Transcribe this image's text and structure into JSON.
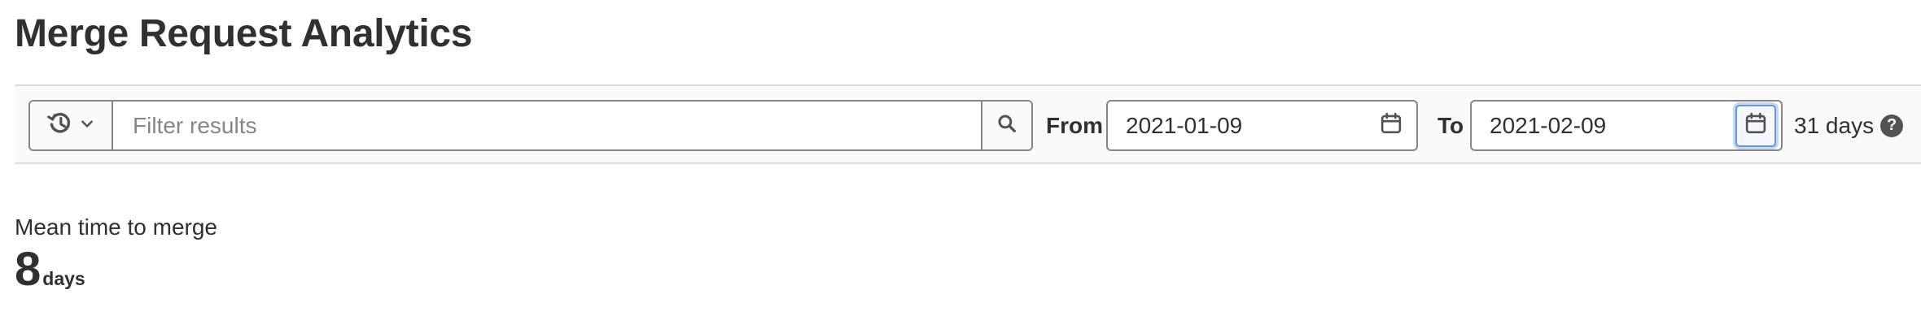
{
  "page": {
    "title": "Merge Request Analytics"
  },
  "filter_bar": {
    "history_icon": "history-icon",
    "dropdown_icon": "chevron-down-icon",
    "search_placeholder": "Filter results",
    "search_value": "",
    "search_icon": "search-icon"
  },
  "date_range": {
    "from_label": "From",
    "from_value": "2021-01-09",
    "to_label": "To",
    "to_value": "2021-02-09",
    "calendar_icon": "calendar-icon",
    "days_count": "31 days",
    "help_icon": "question-icon",
    "help_glyph": "?"
  },
  "metrics": {
    "mean_time_to_merge": {
      "label": "Mean time to merge",
      "value": "8",
      "unit": "days"
    }
  },
  "colors": {
    "text": "#303030",
    "border": "#868686",
    "bar_background": "#fafafa",
    "focus_ring": "#6b96d4"
  }
}
